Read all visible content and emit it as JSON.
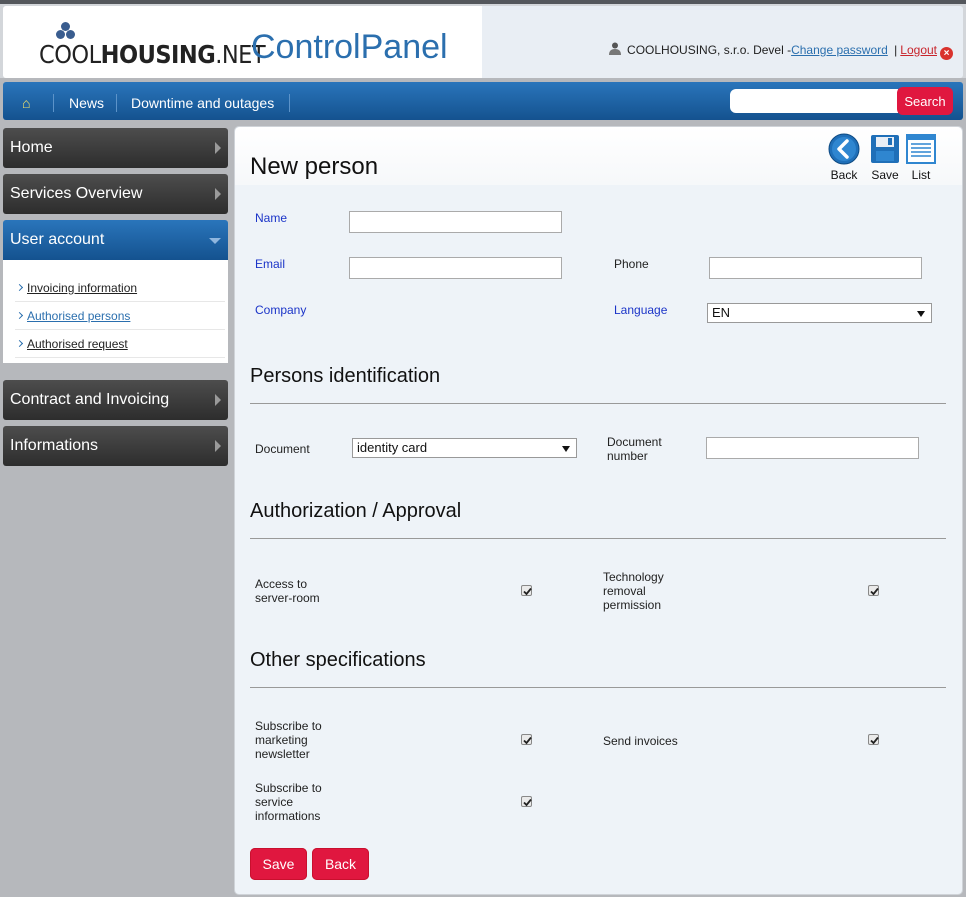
{
  "header": {
    "logo": {
      "part1": "COOL",
      "part2": "HOUSING",
      "part3": ".NET"
    },
    "app_title": "ControlPanel",
    "user": {
      "name": "COOLHOUSING, s.r.o. Devel -",
      "change_password": "Change password",
      "separator": "|",
      "logout": "Logout"
    }
  },
  "nav": {
    "items": [
      {
        "label": "News"
      },
      {
        "label": "Downtime and outages"
      }
    ],
    "search": {
      "placeholder": "",
      "button": "Search"
    }
  },
  "sidebar": {
    "items": [
      {
        "label": "Home"
      },
      {
        "label": "Services Overview"
      },
      {
        "label": "User account"
      },
      {
        "label": "Contract and Invoicing"
      },
      {
        "label": "Informations"
      }
    ],
    "submenu": [
      {
        "label": "Invoicing information"
      },
      {
        "label": "Authorised persons"
      },
      {
        "label": "Authorised request"
      }
    ]
  },
  "page": {
    "title": "New person",
    "tools": {
      "back": "Back",
      "save": "Save",
      "list": "List"
    },
    "fields": {
      "name": {
        "label": "Name",
        "value": ""
      },
      "email": {
        "label": "Email",
        "value": ""
      },
      "phone": {
        "label": "Phone",
        "value": ""
      },
      "company": {
        "label": "Company"
      },
      "language": {
        "label": "Language",
        "value": "EN"
      }
    },
    "identification": {
      "title": "Persons identification",
      "document_label": "Document",
      "document_value": "identity card",
      "number_label_1": "Document",
      "number_label_2": "number",
      "number_value": ""
    },
    "authorization": {
      "title": "Authorization / Approval",
      "access_1": "Access to",
      "access_2": "server-room",
      "access_checked": true,
      "tech_1": "Technology",
      "tech_2": "removal",
      "tech_3": "permission",
      "tech_checked": true
    },
    "other": {
      "title": "Other specifications",
      "newsletter_1": "Subscribe to",
      "newsletter_2": "marketing",
      "newsletter_3": "newsletter",
      "newsletter_checked": true,
      "invoices": "Send invoices",
      "invoices_checked": true,
      "service_1": "Subscribe to",
      "service_2": "service",
      "service_3": "informations",
      "service_checked": true
    },
    "buttons": {
      "save": "Save",
      "back": "Back"
    }
  },
  "colors": {
    "accent": "#2b6fae",
    "button": "#e0173f",
    "nav": "#1d62a6"
  }
}
